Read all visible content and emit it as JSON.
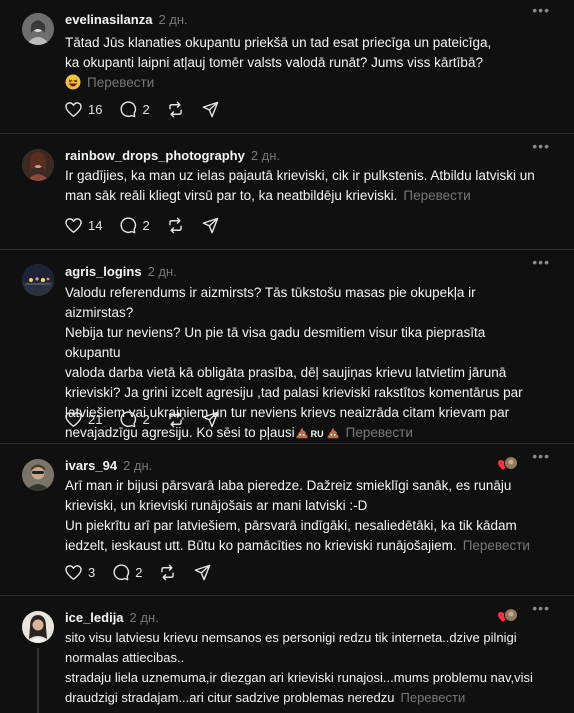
{
  "translate_label": "Перевести",
  "posts": [
    {
      "username": "evelinasilanza",
      "time": "2 дн.",
      "lines": [
        "Tātad Jūs klanaties okupantu priekšā un tad esat priecīga un pateicīga,",
        "ka okupanti laipni atļauj tomēr valsts valodā runāt? Jums viss kārtībā?"
      ],
      "likes": "16",
      "replies": "2",
      "has_emoji_line": true
    },
    {
      "username": "rainbow_drops_photography",
      "time": "2 дн.",
      "lines": [
        "Ir gadījies, ka man uz ielas pajautā krieviski, cik ir pulkstenis. Atbildu latviski un",
        "man sāk reāli kliegt virsū par to, ka neatbildēju krieviski."
      ],
      "likes": "14",
      "replies": "2"
    },
    {
      "username": "agris_logins",
      "time": "2 дн.",
      "lines": [
        "Valodu referendums ir aizmirsts? Tās tūkstošu masas pie okupekļa ir aizmirstas?",
        "Nebija tur neviens? Un pie tā visa gadu desmitiem visur tika pieprasīta okupantu",
        "valoda darba vietā kā obligāta prasība, dēļ saujiņas krievu latvietim jārunā",
        "krieviski? Ja grini izcelt agresiju ,tad palasi krieviski rakstītos komentārus par",
        "latviešiem vai ukraiņiem un tur neviens krievs neaizrāda citam krievam par",
        "nevajadzīgu agresiju. Ko sēsi to pļausi"
      ],
      "ru_badge": "RU",
      "likes": "21",
      "replies": "2"
    },
    {
      "username": "ivars_94",
      "time": "2 дн.",
      "lines": [
        "Arī man ir bijusi pārsvarā laba pieredze. Dažreiz smieklīgi sanāk, es runāju",
        "krieviski, un krieviski runājošais ar mani latviski :-D",
        "Un piekrītu arī par latviešiem, pārsvarā indīgāki, nesaliedētāki, ka tik kādam",
        "iedzelt, ieskaust utt. Būtu ko pamācīties no krieviski runājošajiem."
      ],
      "likes": "3",
      "replies": "2"
    },
    {
      "username": "ice_ledija",
      "time": "2 дн.",
      "lines": [
        "sito visu latviesu krievu nemsanos es personigi redzu tik interneta..dzive pilnigi",
        "normalas attiecibas..",
        "stradaju liela uznemuma,ir diezgan ari krieviski runajosi...mums problemu nav,visi",
        "draudzigi stradajam...ari citur sadzive problemas neredzu"
      ]
    }
  ],
  "colors": {
    "background": "#101010",
    "text": "#f3f5f7",
    "muted": "#777777",
    "divider": "#2d2d2d",
    "like_red": "#ff3040"
  },
  "icons": [
    "heart-icon",
    "comment-icon",
    "repost-icon",
    "share-icon",
    "more-icon",
    "laughing-emoji",
    "poop-emoji"
  ]
}
